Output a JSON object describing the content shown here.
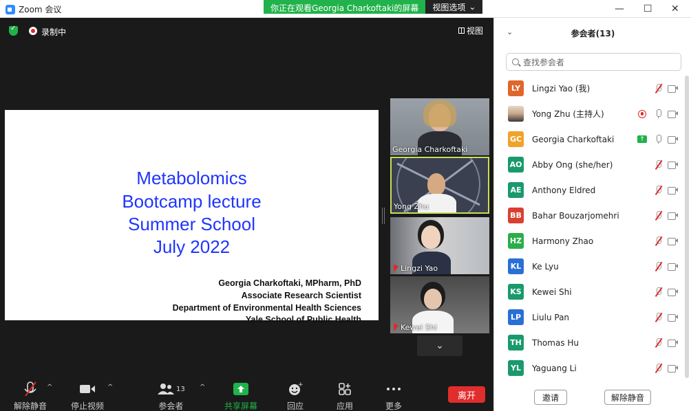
{
  "window": {
    "title": "Zoom 会议",
    "viewing_banner": "你正在观看Georgia  Charkoftaki的屏幕",
    "view_options": "视图选项",
    "view_options_caret": "⌄"
  },
  "meeting": {
    "recording_label": "录制中",
    "view_label": "视图"
  },
  "slide": {
    "title_lines": [
      "Metabolomics",
      "Bootcamp lecture",
      "Summer School",
      "July 2022"
    ],
    "author_lines": [
      "Georgia Charkoftaki, MPharm, PhD",
      "Associate Research Scientist",
      "Department of Environmental Health Sciences",
      "Yale School of Public Health"
    ],
    "title_color": "#1f35ff"
  },
  "video_tiles": [
    {
      "name": "Georgia Charkoftaki",
      "muted": false,
      "active": false
    },
    {
      "name": "Yong Zhu",
      "muted": false,
      "active": true
    },
    {
      "name": "Lingzi Yao",
      "muted": true,
      "active": false
    },
    {
      "name": "Kewei Shi",
      "muted": true,
      "active": false
    }
  ],
  "more_tiles_glyph": "⌄",
  "toolbar": {
    "unmute": "解除静音",
    "stop_video": "停止视频",
    "participants": "参会者",
    "participants_count": "13",
    "share_screen": "共享屏幕",
    "reactions": "回应",
    "apps": "应用",
    "more": "更多",
    "leave": "离开",
    "caret": "^",
    "share_color": "#21b24b",
    "leave_color": "#e22d2d"
  },
  "panel": {
    "title": "参会者(13)",
    "search_placeholder": "查找参会者",
    "participants": [
      {
        "initials": "LY",
        "name": "Lingzi Yao (我)",
        "color": "#e0662b",
        "mic": "muted"
      },
      {
        "initials": "",
        "name": "Yong Zhu (主持人)",
        "color": "#b7c4d6",
        "mic": "on",
        "recording": true,
        "photo": true
      },
      {
        "initials": "GC",
        "name": "Georgia Charkoftaki",
        "color": "#f0a22a",
        "mic": "on",
        "sharing": true
      },
      {
        "initials": "AO",
        "name": "Abby Ong (she/her)",
        "color": "#1a9a6c",
        "mic": "muted"
      },
      {
        "initials": "AE",
        "name": "Anthony Eldred",
        "color": "#1a9a6c",
        "mic": "muted"
      },
      {
        "initials": "BB",
        "name": "Bahar Bouzarjomehri",
        "color": "#d94032",
        "mic": "muted"
      },
      {
        "initials": "HZ",
        "name": "Harmony Zhao",
        "color": "#2aae4a",
        "mic": "muted"
      },
      {
        "initials": "KL",
        "name": "Ke Lyu",
        "color": "#2a6fd6",
        "mic": "muted"
      },
      {
        "initials": "KS",
        "name": "Kewei Shi",
        "color": "#1a9a6c",
        "mic": "muted"
      },
      {
        "initials": "LP",
        "name": "Liulu Pan",
        "color": "#2a6fd6",
        "mic": "muted"
      },
      {
        "initials": "TH",
        "name": "Thomas Hu",
        "color": "#1a9a6c",
        "mic": "muted"
      },
      {
        "initials": "YL",
        "name": "Yaguang Li",
        "color": "#1a9a6c",
        "mic": "muted"
      }
    ],
    "invite": "邀请",
    "unmute_all": "解除静音"
  }
}
